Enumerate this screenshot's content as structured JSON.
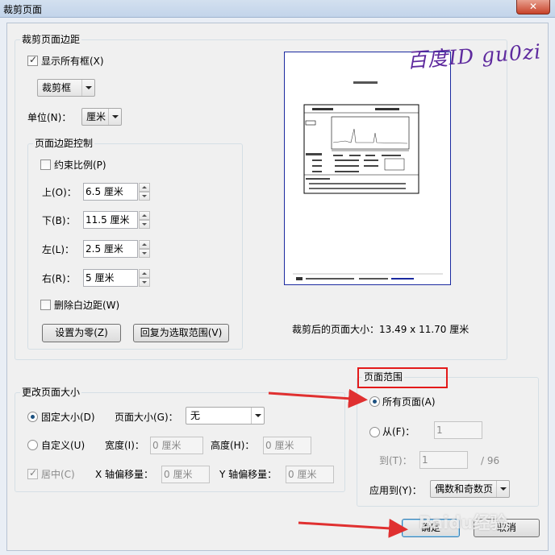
{
  "window": {
    "title": "裁剪页面",
    "close_icon": "close-icon"
  },
  "margins": {
    "group_title": "裁剪页面边距",
    "show_all_boxes": {
      "label": "显示所有框(X)",
      "checked": true
    },
    "box_select": "裁剪框",
    "unit": {
      "label": "单位(N)：",
      "value": "厘米"
    },
    "control": {
      "group_title": "页面边距控制",
      "constrain": {
        "label": "约束比例(P)",
        "checked": false
      },
      "top": {
        "label": "上(O)：",
        "value": "6.5 厘米"
      },
      "bottom": {
        "label": "下(B)：",
        "value": "11.5 厘米"
      },
      "left": {
        "label": "左(L)：",
        "value": "2.5 厘米"
      },
      "right": {
        "label": "右(R)：",
        "value": "5 厘米"
      },
      "remove_white": {
        "label": "删除白边距(W)",
        "checked": false
      },
      "set_zero": "设置为零(Z)",
      "revert": "回复为选取范围(V)"
    },
    "cropped_size": "裁剪后的页面大小：13.49 x 11.70 厘米"
  },
  "change_size": {
    "group_title": "更改页面大小",
    "fixed": {
      "label": "固定大小(D)",
      "selected": true
    },
    "page_size": {
      "label": "页面大小(G)：",
      "value": "无"
    },
    "custom": {
      "label": "自定义(U)",
      "selected": false
    },
    "width": {
      "label": "宽度(I)：",
      "value": "0 厘米"
    },
    "height": {
      "label": "高度(H)：",
      "value": "0 厘米"
    },
    "center": {
      "label": "居中(C)",
      "checked": true,
      "enabled": false
    },
    "x_offset": {
      "label": "X 轴偏移量：",
      "value": "0 厘米"
    },
    "y_offset": {
      "label": "Y 轴偏移量：",
      "value": "0 厘米"
    }
  },
  "range": {
    "group_title": "页面范围",
    "all": {
      "label": "所有页面(A)",
      "selected": true
    },
    "from": {
      "label": "从(F)：",
      "value": "1",
      "selected": false
    },
    "to": {
      "label": "到(T)：",
      "value": "1"
    },
    "total": "/ 96",
    "apply_to": {
      "label": "应用到(Y)：",
      "value": "偶数和奇数页"
    }
  },
  "buttons": {
    "ok": "确定",
    "cancel": "取消"
  },
  "watermark": "百度ID  gu0zi",
  "baidu_logo": "Baidu经验",
  "colors": {
    "highlight": "#e31a1a",
    "arrow": "#e03030",
    "watermark": "#5e2a9e",
    "preview_border": "#1b2aa0"
  }
}
